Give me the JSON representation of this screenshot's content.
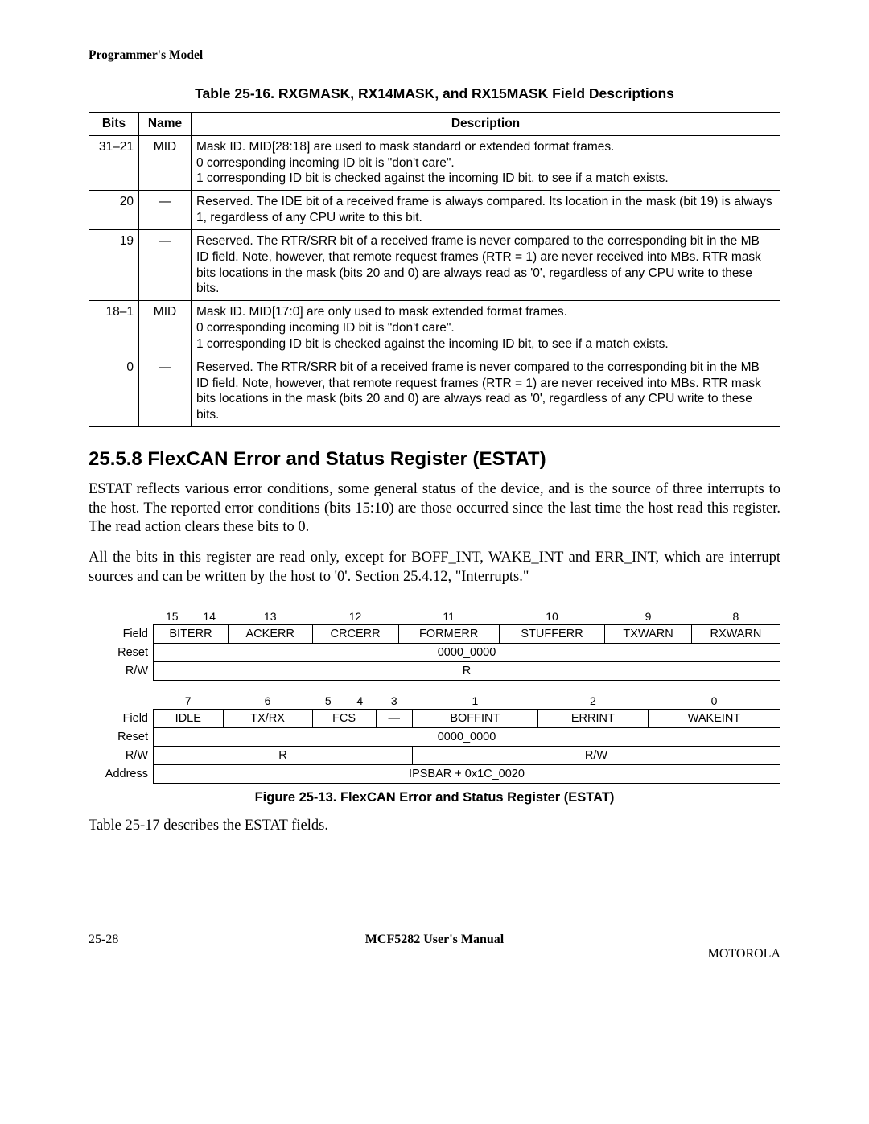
{
  "header": "Programmer's Model",
  "table_caption": "Table 25-16. RXGMASK, RX14MASK, and RX15MASK Field Descriptions",
  "desc_headers": {
    "bits": "Bits",
    "name": "Name",
    "description": "Description"
  },
  "rows": [
    {
      "bits": "31–21",
      "name": "MID",
      "desc": "Mask ID. MID[28:18] are used to mask standard or extended format frames.",
      "sub0": "0  corresponding incoming ID bit is \"don't care\".",
      "sub1": "1  corresponding ID bit is checked against the incoming ID bit, to see if a match exists."
    },
    {
      "bits": "20",
      "name": "—",
      "desc": "Reserved. The IDE bit of a received frame is always compared. Its location in the mask (bit 19) is always 1, regardless of any CPU write to this bit."
    },
    {
      "bits": "19",
      "name": "—",
      "desc": "Reserved. The RTR/SRR bit of a received frame is never compared to the corresponding bit in the MB ID field. Note, however, that remote request frames (RTR = 1) are never received into MBs. RTR mask bits locations in the mask (bits 20 and 0) are always read as '0', regardless of any CPU write to these bits."
    },
    {
      "bits": "18–1",
      "name": "MID",
      "desc": "Mask ID. MID[17:0] are only used to mask extended format frames.",
      "sub0": "0  corresponding incoming ID bit is \"don't care\".",
      "sub1": "1  corresponding ID bit is checked against the incoming ID bit, to see if a match exists."
    },
    {
      "bits": "0",
      "name": "—",
      "desc": "Reserved. The RTR/SRR bit of a received frame is never compared to the corresponding bit in the MB ID field. Note, however, that remote request frames (RTR = 1) are never received into MBs. RTR mask bits locations in the mask (bits 20 and 0) are always read as '0', regardless of any CPU write to these bits."
    }
  ],
  "section_heading": "25.5.8  FlexCAN Error and Status Register (ESTAT)",
  "para1": "ESTAT reflects various error conditions, some general status of the device, and is the source of three interrupts to the host. The reported error conditions (bits 15:10) are those occurred since the last time the host read this register. The read action clears these bits to 0.",
  "para2": "All the bits in this register are read only, except for BOFF_INT, WAKE_INT and ERR_INT, which are interrupt sources and can be written by the host to '0'. Section 25.4.12, \"Interrupts.\"",
  "reg": {
    "labels": {
      "field": "Field",
      "reset": "Reset",
      "rw": "R/W",
      "address": "Address"
    },
    "bits_hi": [
      "15",
      "14",
      "13",
      "12",
      "11",
      "10",
      "9",
      "8"
    ],
    "fields_hi": [
      "BITERR",
      "ACKERR",
      "CRCERR",
      "FORMERR",
      "STUFFERR",
      "TXWARN",
      "RXWARN"
    ],
    "reset_hi": "0000_0000",
    "rw_hi": "R",
    "bits_lo": [
      "7",
      "6",
      "5",
      "4",
      "3",
      "1",
      "2",
      "0"
    ],
    "fields_lo": [
      "IDLE",
      "TX/RX",
      "FCS",
      "—",
      "BOFFINT",
      "ERRINT",
      "WAKEINT"
    ],
    "reset_lo": "0000_0000",
    "rw_lo_r": "R",
    "rw_lo_rw": "R/W",
    "address": "IPSBAR + 0x1C_0020"
  },
  "fig_caption": "Figure 25-13. FlexCAN Error and Status Register (ESTAT)",
  "para3": "Table 25-17 describes the ESTAT fields.",
  "footer": {
    "left": "25-28",
    "mid": "MCF5282 User's Manual",
    "right": "MOTOROLA"
  }
}
